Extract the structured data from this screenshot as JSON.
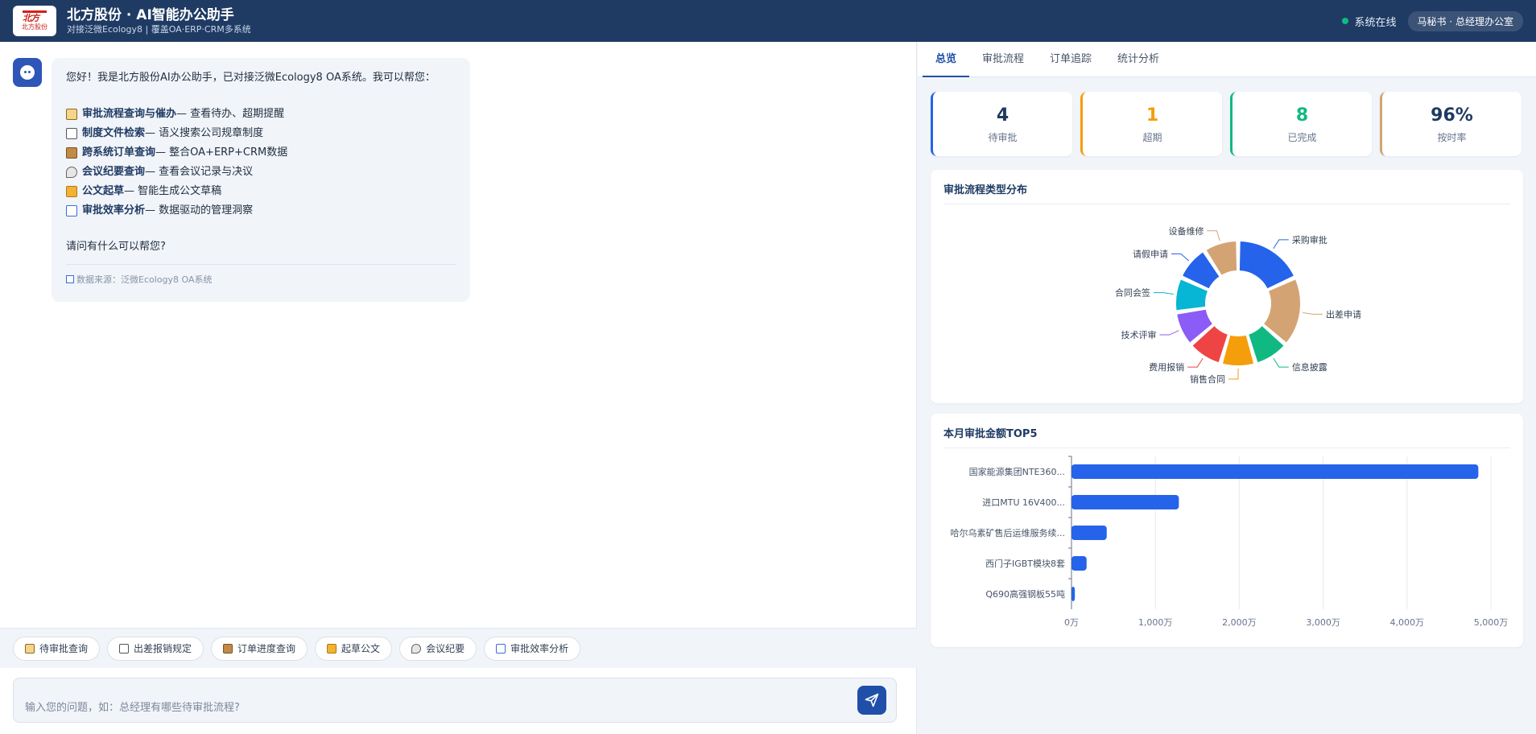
{
  "header": {
    "logo_mark": "北方",
    "logo_text": "北方股份",
    "title": "北方股份 · AI智能办公助手",
    "subtitle": "对接泛微Ecology8 | 覆盖OA·ERP·CRM多系统",
    "status": "系统在线",
    "user": "马秘书 · 总经理办公室",
    "status_color": "#10b981"
  },
  "chat": {
    "greeting": "您好！我是北方股份AI办公助手，已对接泛微Ecology8 OA系统。我可以帮您：",
    "features": [
      {
        "icon": "clipboard-icon",
        "title": "审批流程查询与催办",
        "desc": " — 查看待办、超期提醒"
      },
      {
        "icon": "document-icon",
        "title": "制度文件检索",
        "desc": " — 语义搜索公司规章制度"
      },
      {
        "icon": "package-icon",
        "title": "跨系统订单查询",
        "desc": " — 整合OA+ERP+CRM数据"
      },
      {
        "icon": "pushpin-icon",
        "title": "会议纪要查询",
        "desc": " — 查看会议记录与决议"
      },
      {
        "icon": "pen-icon",
        "title": "公文起草",
        "desc": " — 智能生成公文草稿"
      },
      {
        "icon": "bar-chart-icon",
        "title": "审批效率分析",
        "desc": " — 数据驱动的管理洞察"
      }
    ],
    "question": "请问有什么可以帮您?",
    "source": "数据来源：泛微Ecology8 OA系统"
  },
  "quick_actions": [
    {
      "icon": "clipboard-icon",
      "label": "待审批查询"
    },
    {
      "icon": "document-icon",
      "label": "出差报销规定"
    },
    {
      "icon": "package-icon",
      "label": "订单进度查询"
    },
    {
      "icon": "pen-icon",
      "label": "起草公文"
    },
    {
      "icon": "pushpin-icon",
      "label": "会议纪要"
    },
    {
      "icon": "bar-chart-icon",
      "label": "审批效率分析"
    }
  ],
  "input": {
    "placeholder": "输入您的问题，如：总经理有哪些待审批流程?",
    "value": ""
  },
  "tabs": [
    {
      "label": "总览",
      "active": true
    },
    {
      "label": "审批流程",
      "active": false
    },
    {
      "label": "订单追踪",
      "active": false
    },
    {
      "label": "统计分析",
      "active": false
    }
  ],
  "stats": [
    {
      "value": "4",
      "label": "待审批",
      "color": "#1e3a5f",
      "accent": "#2563eb"
    },
    {
      "value": "1",
      "label": "超期",
      "color": "#f59e0b",
      "accent": "#f59e0b"
    },
    {
      "value": "8",
      "label": "已完成",
      "color": "#10b981",
      "accent": "#10b981"
    },
    {
      "value": "96%",
      "label": "按时率",
      "color": "#1e3a5f",
      "accent": "#d4a373"
    }
  ],
  "chart_data": [
    {
      "type": "pie",
      "title": "审批流程类型分布",
      "donut": true,
      "legend": "labels-outside",
      "categories": [
        "采购审批",
        "出差申请",
        "信息披露",
        "销售合同",
        "费用报销",
        "技术评审",
        "合同会签",
        "请假申请",
        "设备维修"
      ],
      "values": [
        2,
        2,
        1,
        1,
        1,
        1,
        1,
        1,
        1
      ],
      "colors": [
        "#2563eb",
        "#d4a373",
        "#10b981",
        "#f59e0b",
        "#ef4444",
        "#8b5cf6",
        "#06b6d4",
        "#2563eb",
        "#d4a373"
      ]
    },
    {
      "type": "bar",
      "orientation": "horizontal",
      "title": "本月审批金额TOP5",
      "categories": [
        "国家能源集团NTE360...",
        "进口MTU 16V400...",
        "哈尔乌素矿售后运维服务续...",
        "西门子IGBT模块8套",
        "Q690高强钢板55吨"
      ],
      "values": [
        4850,
        1280,
        420,
        180,
        40
      ],
      "xlim": [
        0,
        5000
      ],
      "xticks": [
        0,
        1000,
        2000,
        3000,
        4000,
        5000
      ],
      "xtick_labels": [
        "0万",
        "1,000万",
        "2,000万",
        "3,000万",
        "4,000万",
        "5,000万"
      ],
      "grid": true,
      "color": "#2563eb"
    }
  ]
}
